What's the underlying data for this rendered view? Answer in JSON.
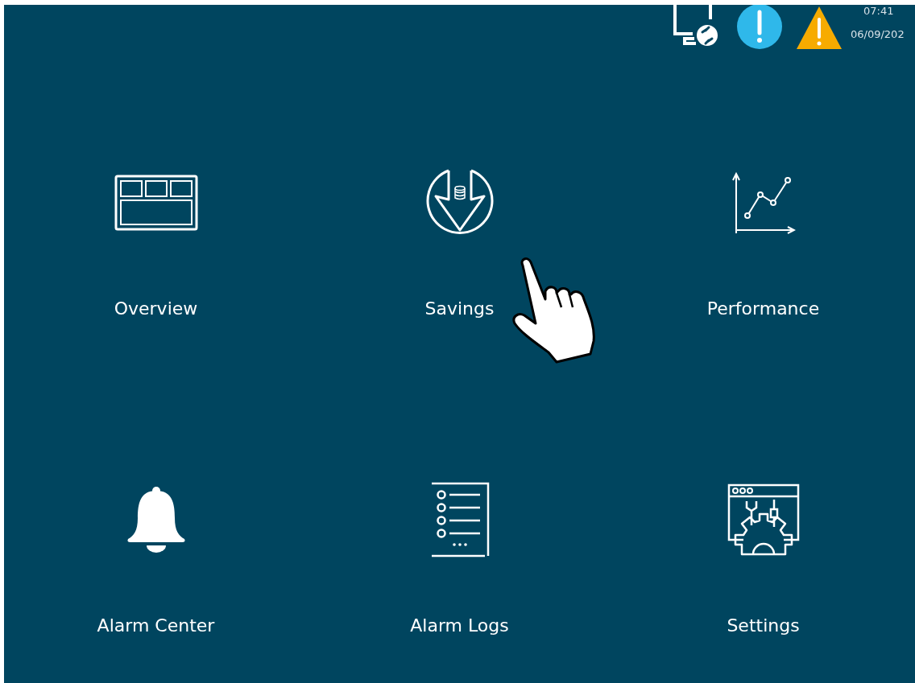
{
  "status_bar": {
    "time": "07:41",
    "date": "06/09/202"
  },
  "tiles": [
    {
      "kind": "overview",
      "label": "Overview"
    },
    {
      "kind": "savings",
      "label": "Savings"
    },
    {
      "kind": "performance",
      "label": "Performance"
    },
    {
      "kind": "alarm_center",
      "label": "Alarm Center"
    },
    {
      "kind": "alarm_logs",
      "label": "Alarm Logs"
    },
    {
      "kind": "settings",
      "label": "Settings"
    }
  ]
}
